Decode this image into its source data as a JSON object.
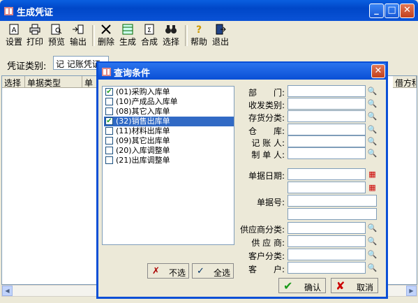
{
  "window": {
    "title": "生成凭证"
  },
  "toolbar": {
    "buttons": [
      {
        "label": "设置"
      },
      {
        "label": "打印"
      },
      {
        "label": "预览"
      },
      {
        "label": "输出"
      },
      {
        "label": "删除"
      },
      {
        "label": "生成"
      },
      {
        "label": "合成"
      },
      {
        "label": "选择"
      },
      {
        "label": "帮助"
      },
      {
        "label": "退出"
      }
    ]
  },
  "voucher_type": {
    "label": "凭证类别:",
    "value": "记 记账凭证"
  },
  "grid": {
    "columns": [
      "选择",
      "单据类型",
      "单",
      "借方科"
    ]
  },
  "dialog": {
    "title": "查询条件",
    "documents": [
      {
        "label": "(01)采购入库单",
        "checked": true,
        "selected": false
      },
      {
        "label": "(10)产成品入库单",
        "checked": false,
        "selected": false
      },
      {
        "label": "(08)其它入库单",
        "checked": false,
        "selected": false
      },
      {
        "label": "(32)销售出库单",
        "checked": true,
        "selected": true
      },
      {
        "label": "(11)材料出库单",
        "checked": false,
        "selected": false
      },
      {
        "label": "(09)其它出库单",
        "checked": false,
        "selected": false
      },
      {
        "label": "(20)入库调整单",
        "checked": false,
        "selected": false
      },
      {
        "label": "(21)出库调整单",
        "checked": false,
        "selected": false
      }
    ],
    "fields": {
      "department": "部　　门:",
      "receive_send_type": "收发类别:",
      "inventory_class": "存货分类:",
      "warehouse": "仓　　库:",
      "bookkeeper": "记 账 人:",
      "maker": "制 单 人:",
      "doc_date": "单据日期:",
      "doc_no": "单据号:",
      "supplier_class": "供应商分类:",
      "supplier": "供 应 商:",
      "customer_class": "客户分类:",
      "customer": "客　　户:"
    },
    "buttons": {
      "deselect": "不选",
      "select_all": "全选",
      "ok": "确认",
      "cancel": "取消"
    }
  },
  "colors": {
    "titlebar": "#0a52d6",
    "selection": "#316ac5",
    "check": "#21a121"
  }
}
